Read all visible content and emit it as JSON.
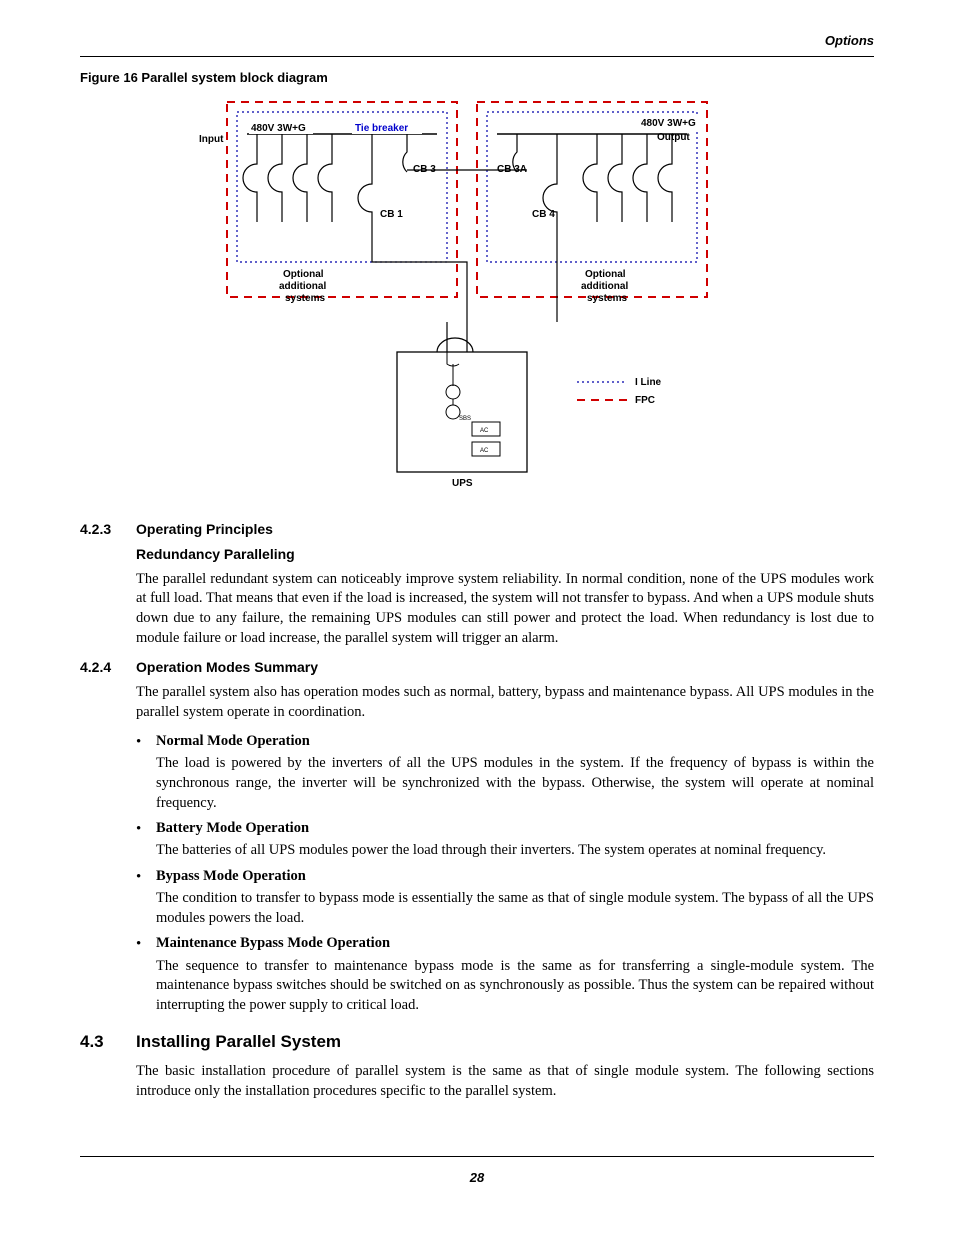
{
  "header": {
    "right": "Options"
  },
  "figure": {
    "caption": "Figure 16  Parallel system block diagram",
    "labels": {
      "input": "Input",
      "volts_left": "480V 3W+G",
      "tie_breaker": "Tie breaker",
      "volts_right": "480V 3W+G",
      "output": "Output",
      "cb3": "CB 3",
      "cb3a": "CB 3A",
      "cb1": "CB 1",
      "cb4": "CB 4",
      "opt_left_1": "Optional",
      "opt_left_2": "additional",
      "opt_left_3": "systems",
      "opt_right_1": "Optional",
      "opt_right_2": "additional",
      "opt_right_3": "systems",
      "sbs": "SBS",
      "ac1": "AC",
      "ac2": "AC",
      "ups": "UPS",
      "legend_iline": "I Line",
      "legend_fpc": "FPC"
    }
  },
  "s423": {
    "num": "4.2.3",
    "title": "Operating Principles",
    "subhead": "Redundancy Paralleling",
    "para": "The parallel redundant system can noticeably improve system reliability. In normal condition, none of the UPS modules work at full load. That means that even if the load is increased, the system will not transfer to bypass. And when a UPS module shuts down due to any failure, the remaining UPS modules can still power and protect the load. When redundancy is lost due to module failure or load increase, the parallel system will trigger an alarm."
  },
  "s424": {
    "num": "4.2.4",
    "title": "Operation Modes Summary",
    "intro": "The parallel system also has operation modes such as normal, battery, bypass and maintenance bypass. All UPS modules in the parallel system operate in coordination.",
    "bullets": [
      {
        "title": "Normal Mode Operation",
        "body": "The load is powered by the inverters of all the UPS modules in the system. If the frequency of bypass is within the synchronous range, the inverter will be synchronized with the bypass. Otherwise, the system will operate at nominal frequency."
      },
      {
        "title": "Battery Mode Operation",
        "body": "The batteries of all UPS modules power the load through their inverters. The system operates at nominal frequency."
      },
      {
        "title": "Bypass Mode Operation",
        "body": "The condition to transfer to bypass mode is essentially the same as that of single module system. The bypass of all the UPS modules powers the load."
      },
      {
        "title": "Maintenance Bypass Mode Operation",
        "body": "The sequence to transfer to maintenance bypass mode is the same as for transferring a single-module system. The maintenance bypass switches should be switched on as synchronously as possible. Thus the system can be repaired without interrupting the power supply to critical load."
      }
    ]
  },
  "s43": {
    "num": "4.3",
    "title": "Installing Parallel System",
    "para": "The basic installation procedure of parallel system is the same as that of single module system. The following sections introduce only the installation procedures specific to the parallel system."
  },
  "footer": {
    "page": "28"
  }
}
